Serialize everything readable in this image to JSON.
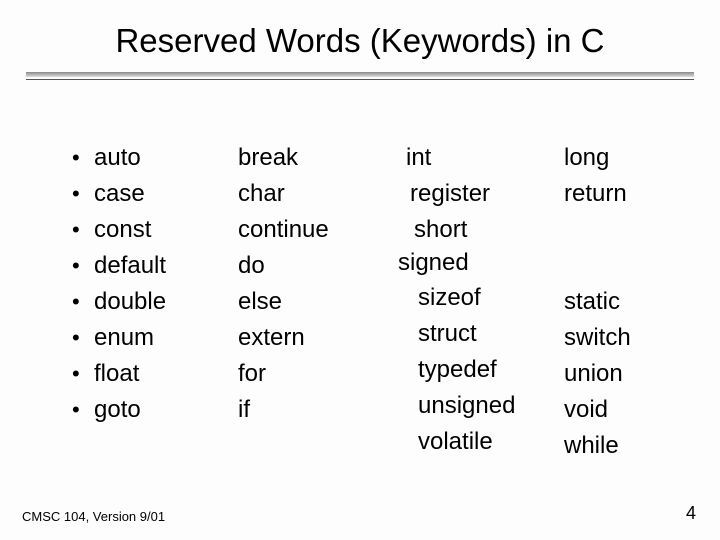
{
  "title": "Reserved Words (Keywords) in C",
  "col1": [
    "auto",
    "case",
    "const",
    "default",
    "double",
    "enum",
    "float",
    "goto"
  ],
  "col2": [
    "break",
    "char",
    "continue",
    "do",
    "else",
    "extern",
    "for",
    "if"
  ],
  "col3": [
    "int",
    "register",
    "short",
    "signed",
    "sizeof",
    "struct",
    "typedef",
    "unsigned",
    "volatile"
  ],
  "col4_top": [
    "long",
    "return"
  ],
  "col4_bottom": [
    "static",
    "switch",
    "union",
    "void",
    "while"
  ],
  "footer_left": "CMSC 104, Version 9/01",
  "footer_right": "4"
}
